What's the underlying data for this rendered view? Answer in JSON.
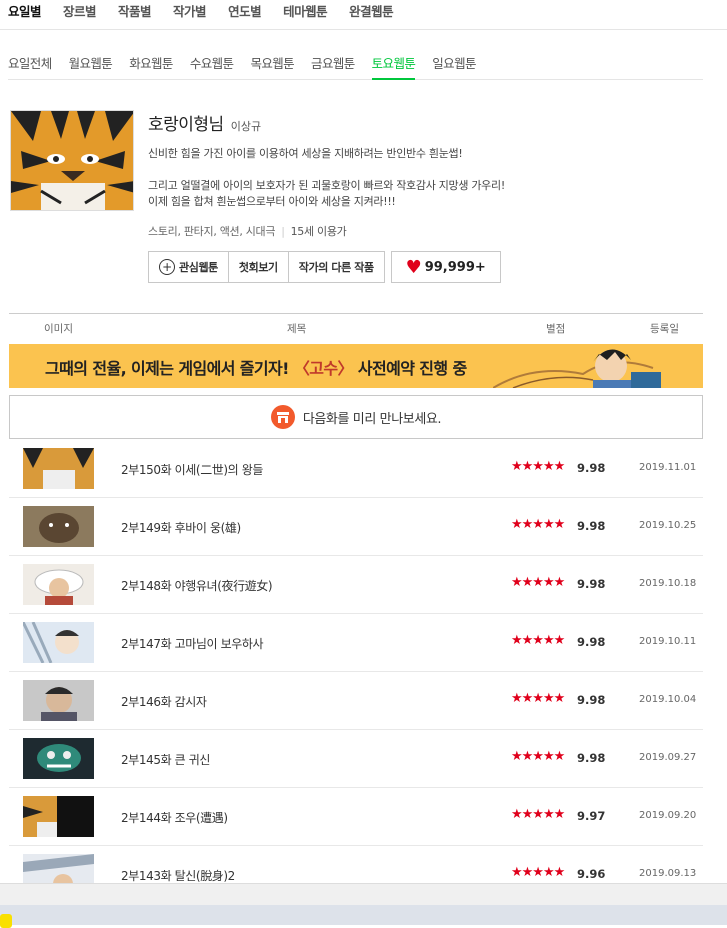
{
  "top_tabs": [
    "요일별",
    "장르별",
    "작품별",
    "작가별",
    "연도별",
    "테마웹툰",
    "완결웹툰"
  ],
  "day_tabs": [
    "요일전체",
    "월요웹툰",
    "화요웹툰",
    "수요웹툰",
    "목요웹툰",
    "금요웹툰",
    "토요웹툰",
    "일요웹툰"
  ],
  "webtoon": {
    "title": "호랑이형님",
    "author": "이상규",
    "desc1": "신비한 힘을 가진 아이를 이용하여 세상을 지배하려는 반인반수 흰눈썹!",
    "desc2": "그리고 얼떨결에 아이의 보호자가 된 괴물호랑이 빠르와 작호감사 지망생 가우리!",
    "desc3": "이제 힘을 합쳐 흰눈썹으로부터 아이와 세상을 지켜라!!!",
    "genre": "스토리, 판타지, 액션, 시대극",
    "age": "15세 이용가",
    "btn_fav": "관심웹툰",
    "btn_first": "첫회보기",
    "btn_other": "작가의 다른 작품",
    "likes": "99,999+"
  },
  "list_header": {
    "image": "이미지",
    "title": "제목",
    "rating": "별점",
    "date": "등록일"
  },
  "banner": {
    "part1": "그때의 전율, 이제는 게임에서 즐기자! ",
    "highlight": "〈고수〉",
    "part2": " 사전예약 진행 중"
  },
  "preview_text": "다음화를 미리 만나보세요.",
  "colors": {
    "accent_green": "#00c73c",
    "star_red": "#e0001b",
    "banner_yellow": "#fbc34f"
  },
  "episodes": [
    {
      "title": "2부150화 이세(二世)의 왕들",
      "stars": "★★★★★",
      "score": "9.98",
      "date": "2019.11.01"
    },
    {
      "title": "2부149화 후바이 웅(雄)",
      "stars": "★★★★★",
      "score": "9.98",
      "date": "2019.10.25"
    },
    {
      "title": "2부148화 야행유녀(夜行遊女)",
      "stars": "★★★★★",
      "score": "9.98",
      "date": "2019.10.18"
    },
    {
      "title": "2부147화 고마님이 보우하사",
      "stars": "★★★★★",
      "score": "9.98",
      "date": "2019.10.11"
    },
    {
      "title": "2부146화 감시자",
      "stars": "★★★★★",
      "score": "9.98",
      "date": "2019.10.04"
    },
    {
      "title": "2부145화 큰 귀신",
      "stars": "★★★★★",
      "score": "9.98",
      "date": "2019.09.27"
    },
    {
      "title": "2부144화 조우(遭遇)",
      "stars": "★★★★★",
      "score": "9.97",
      "date": "2019.09.20"
    },
    {
      "title": "2부143화 탈신(脫身)2",
      "stars": "★★★★★",
      "score": "9.96",
      "date": "2019.09.13"
    }
  ]
}
